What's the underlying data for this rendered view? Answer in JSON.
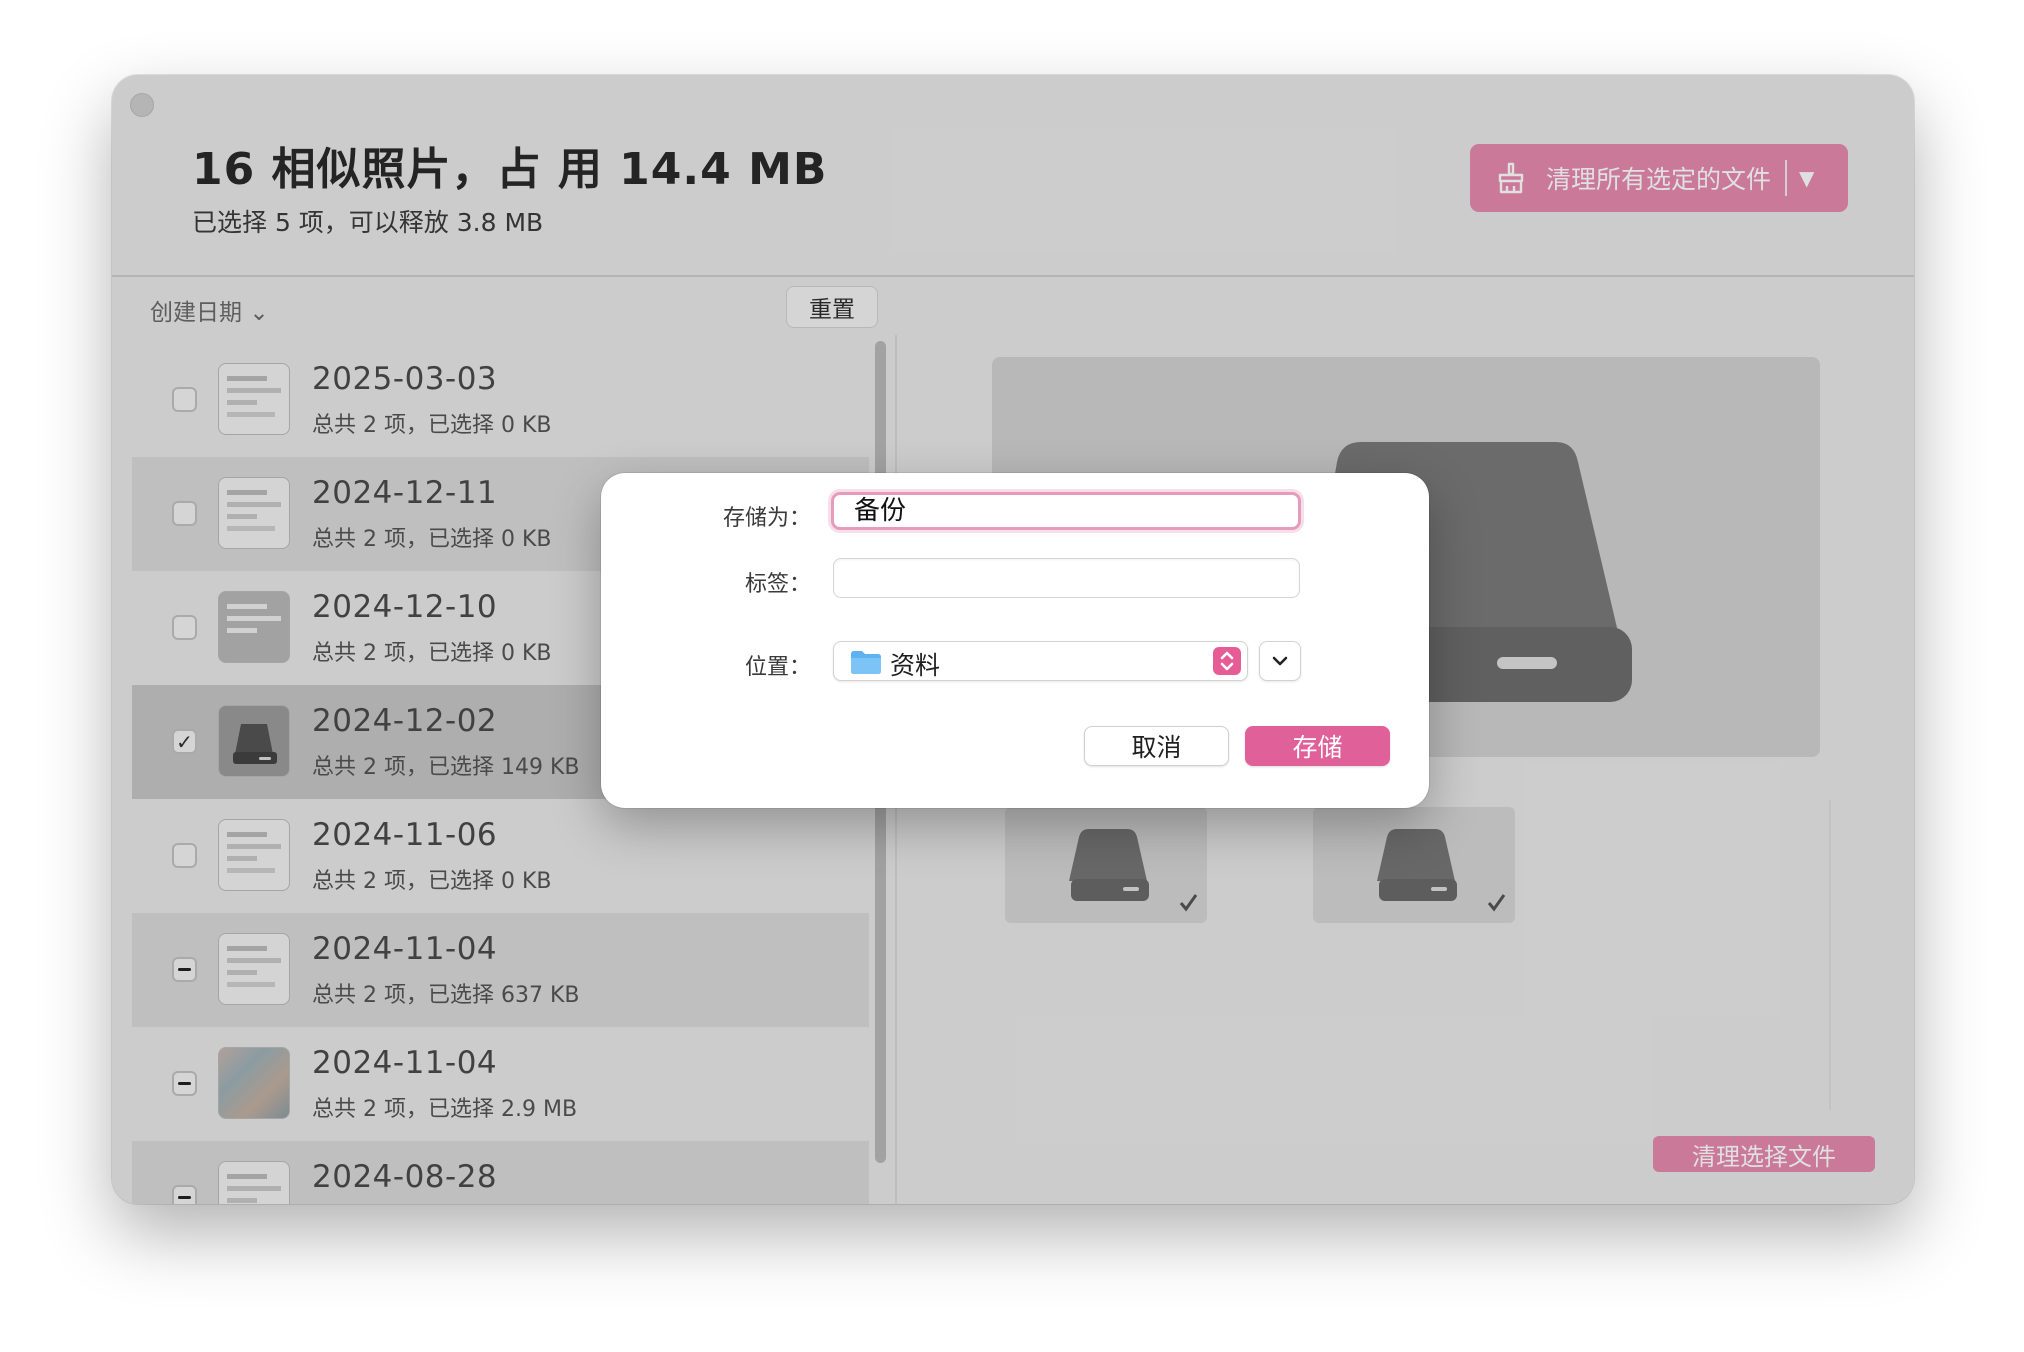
{
  "header": {
    "title": "16 相似照片，占 用 14.4 MB",
    "subtitle": "已选择 5 项，可以释放 3.8 MB",
    "clean_all_label": "清理所有选定的文件",
    "clean_all_icon": "broom-icon",
    "dropdown_caret": "▼"
  },
  "list": {
    "sort_label": "创建日期",
    "sort_caret": "⌄",
    "reset_label": "重置",
    "rows": [
      {
        "date": "2025-03-03",
        "info": "总共 2 项，已选择 0 KB",
        "state": "unchecked"
      },
      {
        "date": "2024-12-11",
        "info": "总共 2 项，已选择 0 KB",
        "state": "unchecked"
      },
      {
        "date": "2024-12-10",
        "info": "总共 2 项，已选择 0 KB",
        "state": "unchecked"
      },
      {
        "date": "2024-12-02",
        "info": "总共 2 项，已选择 149 KB",
        "state": "checked"
      },
      {
        "date": "2024-11-06",
        "info": "总共 2 项，已选择 0 KB",
        "state": "unchecked"
      },
      {
        "date": "2024-11-04",
        "info": "总共 2 项，已选择 637 KB",
        "state": "mixed"
      },
      {
        "date": "2024-11-04",
        "info": "总共 2 项，已选择 2.9 MB",
        "state": "mixed"
      },
      {
        "date": "2024-08-28",
        "info": "",
        "state": "mixed"
      }
    ],
    "check_glyph": "✓"
  },
  "preview": {
    "check_glyph": "✓",
    "clean_selected_label": "清理选择文件"
  },
  "dialog": {
    "save_as_label": "存储为：",
    "save_as_value": "备份",
    "tags_label": "标签：",
    "location_label": "位置：",
    "location_value": "资料",
    "cancel_label": "取消",
    "save_label": "存储"
  },
  "colors": {
    "accent": "#e0609a",
    "accent_dim": "#e68aad"
  }
}
